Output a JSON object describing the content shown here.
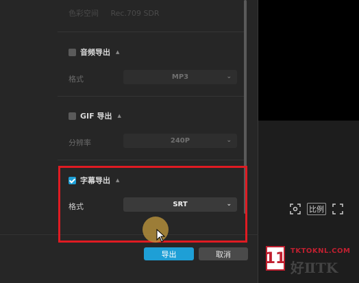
{
  "faded_row": {
    "label": "色彩空间",
    "value": "Rec.709 SDR"
  },
  "audio_section": {
    "title": "音频导出",
    "checked": false,
    "format_label": "格式",
    "format_value": "MP3"
  },
  "gif_section": {
    "title": "GIF 导出",
    "checked": false,
    "resolution_label": "分辨率",
    "resolution_value": "240P"
  },
  "subtitle_section": {
    "title": "字幕导出",
    "checked": true,
    "format_label": "格式",
    "format_value": "SRT"
  },
  "buttons": {
    "export": "导出",
    "cancel": "取消"
  },
  "player_tools": {
    "ratio_label": "比例"
  },
  "watermark": {
    "logo": "11",
    "url": "TKTOKNL.COM",
    "cn": "好ⅡTK"
  },
  "colors": {
    "accent": "#1e9fd6",
    "highlight": "#e01b22",
    "dialog_bg": "#262626"
  }
}
